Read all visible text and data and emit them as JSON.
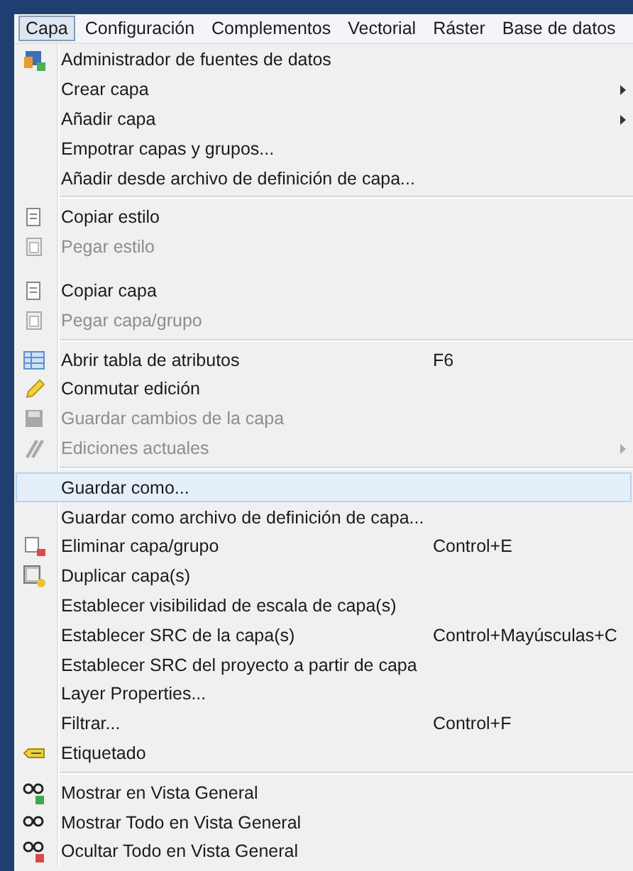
{
  "menubar": [
    {
      "label": "Capa",
      "selected": true
    },
    {
      "label": "Configuración",
      "selected": false
    },
    {
      "label": "Complementos",
      "selected": false
    },
    {
      "label": "Vectorial",
      "selected": false
    },
    {
      "label": "Ráster",
      "selected": false
    },
    {
      "label": "Base de datos",
      "selected": false
    }
  ],
  "menu": [
    {
      "kind": "item",
      "label": "Administrador de fuentes de datos",
      "disabled": false,
      "submenu": false,
      "selected": false
    },
    {
      "kind": "item",
      "label": "Crear capa",
      "disabled": false,
      "submenu": true,
      "selected": false
    },
    {
      "kind": "item",
      "label": "Añadir capa",
      "disabled": false,
      "submenu": true,
      "selected": false
    },
    {
      "kind": "item",
      "label": "Empotrar capas y grupos...",
      "disabled": false,
      "submenu": false,
      "selected": false
    },
    {
      "kind": "item",
      "label": "Añadir desde archivo de definición de capa...",
      "disabled": false,
      "submenu": false,
      "selected": false
    },
    {
      "kind": "separator"
    },
    {
      "kind": "item",
      "label": "Copiar estilo",
      "disabled": false,
      "submenu": false,
      "selected": false
    },
    {
      "kind": "item",
      "label": "Pegar estilo",
      "disabled": true,
      "submenu": false,
      "selected": false
    },
    {
      "kind": "spacer"
    },
    {
      "kind": "item",
      "label": "Copiar capa",
      "disabled": false,
      "submenu": false,
      "selected": false
    },
    {
      "kind": "item",
      "label": "Pegar capa/grupo",
      "disabled": true,
      "submenu": false,
      "selected": false
    },
    {
      "kind": "separator"
    },
    {
      "kind": "item",
      "label": "Abrir tabla de atributos",
      "shortcut": "F6",
      "disabled": false,
      "submenu": false,
      "selected": false
    },
    {
      "kind": "item",
      "label": "Conmutar edición",
      "disabled": false,
      "submenu": false,
      "selected": false
    },
    {
      "kind": "item",
      "label": "Guardar cambios de la capa",
      "disabled": true,
      "submenu": false,
      "selected": false
    },
    {
      "kind": "item",
      "label": "Ediciones actuales",
      "disabled": true,
      "submenu": true,
      "selected": false
    },
    {
      "kind": "separator"
    },
    {
      "kind": "item",
      "label": "Guardar como...",
      "disabled": false,
      "submenu": false,
      "selected": true
    },
    {
      "kind": "item",
      "label": "Guardar como archivo de definición de capa...",
      "disabled": false,
      "submenu": false,
      "selected": false
    },
    {
      "kind": "item",
      "label": "Eliminar capa/grupo",
      "shortcut": "Control+E",
      "disabled": false,
      "submenu": false,
      "selected": false
    },
    {
      "kind": "item",
      "label": "Duplicar capa(s)",
      "disabled": false,
      "submenu": false,
      "selected": false
    },
    {
      "kind": "item",
      "label": "Establecer visibilidad de escala de capa(s)",
      "disabled": false,
      "submenu": false,
      "selected": false
    },
    {
      "kind": "item",
      "label": "Establecer SRC de la capa(s)",
      "shortcut": "Control+Mayúsculas+C",
      "disabled": false,
      "submenu": false,
      "selected": false
    },
    {
      "kind": "item",
      "label": "Establecer SRC del proyecto a partir de capa",
      "disabled": false,
      "submenu": false,
      "selected": false
    },
    {
      "kind": "item",
      "label": "Layer Properties...",
      "disabled": false,
      "submenu": false,
      "selected": false
    },
    {
      "kind": "item",
      "label": "Filtrar...",
      "shortcut": "Control+F",
      "disabled": false,
      "submenu": false,
      "selected": false
    },
    {
      "kind": "item",
      "label": "Etiquetado",
      "disabled": false,
      "submenu": false,
      "selected": false
    },
    {
      "kind": "separator"
    },
    {
      "kind": "item",
      "label": "Mostrar en Vista General",
      "disabled": false,
      "submenu": false,
      "selected": false
    },
    {
      "kind": "item",
      "label": "Mostrar Todo en Vista General",
      "disabled": false,
      "submenu": false,
      "selected": false
    },
    {
      "kind": "item",
      "label": "Ocultar Todo en Vista General",
      "disabled": false,
      "submenu": false,
      "selected": false
    }
  ]
}
